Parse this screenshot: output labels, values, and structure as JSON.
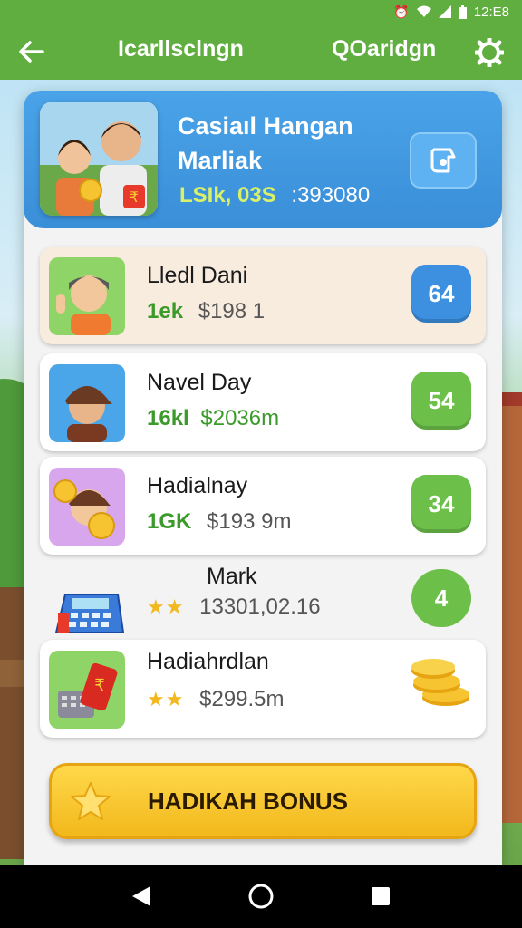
{
  "status_bar": {
    "time": "12:E8",
    "icons": [
      "alarm-icon",
      "wifi-icon",
      "signal-icon",
      "battery-icon"
    ]
  },
  "app_bar": {
    "title_left": "Icarllsclngn",
    "title_right": "QOaridgn",
    "back_icon": "arrow-left-icon",
    "settings_icon": "gear-icon"
  },
  "header": {
    "title_line1": "Casiaıl Hangan",
    "title_line2": "Marliak",
    "stat_green": "LSIk, 03S",
    "stat_white": ":393080",
    "action_icon": "share-icon"
  },
  "list": [
    {
      "name": "Lledl Dani",
      "sub_green": "1ek",
      "sub_gray": "$198 1",
      "badge": "64",
      "badge_color": "#3d8fe0"
    },
    {
      "name": "Navel Day",
      "sub_green": "16kl",
      "sub_gray": "$2036m",
      "badge": "54",
      "badge_color": "#6cc04a"
    },
    {
      "name": "Hadialnay",
      "sub_green": "1GK",
      "sub_gray": "$193 9m",
      "badge": "34",
      "badge_color": "#6cc04a"
    },
    {
      "name": "Mark",
      "stars": "★★",
      "sub_gray": "13301,02.16",
      "badge": "4",
      "badge_color": "#6cc04a"
    },
    {
      "name": "Hadiahrdlan",
      "stars": "★★",
      "sub_gray": "$299.5m",
      "badge_icon": "coins-icon"
    }
  ],
  "bonus": {
    "label": "HADIKAH BONUS",
    "icon": "star-icon"
  },
  "nav": {
    "back": "nav-back-icon",
    "home": "nav-home-icon",
    "recents": "nav-recents-icon"
  },
  "colors": {
    "app_bar": "#5fae3f",
    "header": "#3a8fd8",
    "bonus": "#f2b81c"
  }
}
